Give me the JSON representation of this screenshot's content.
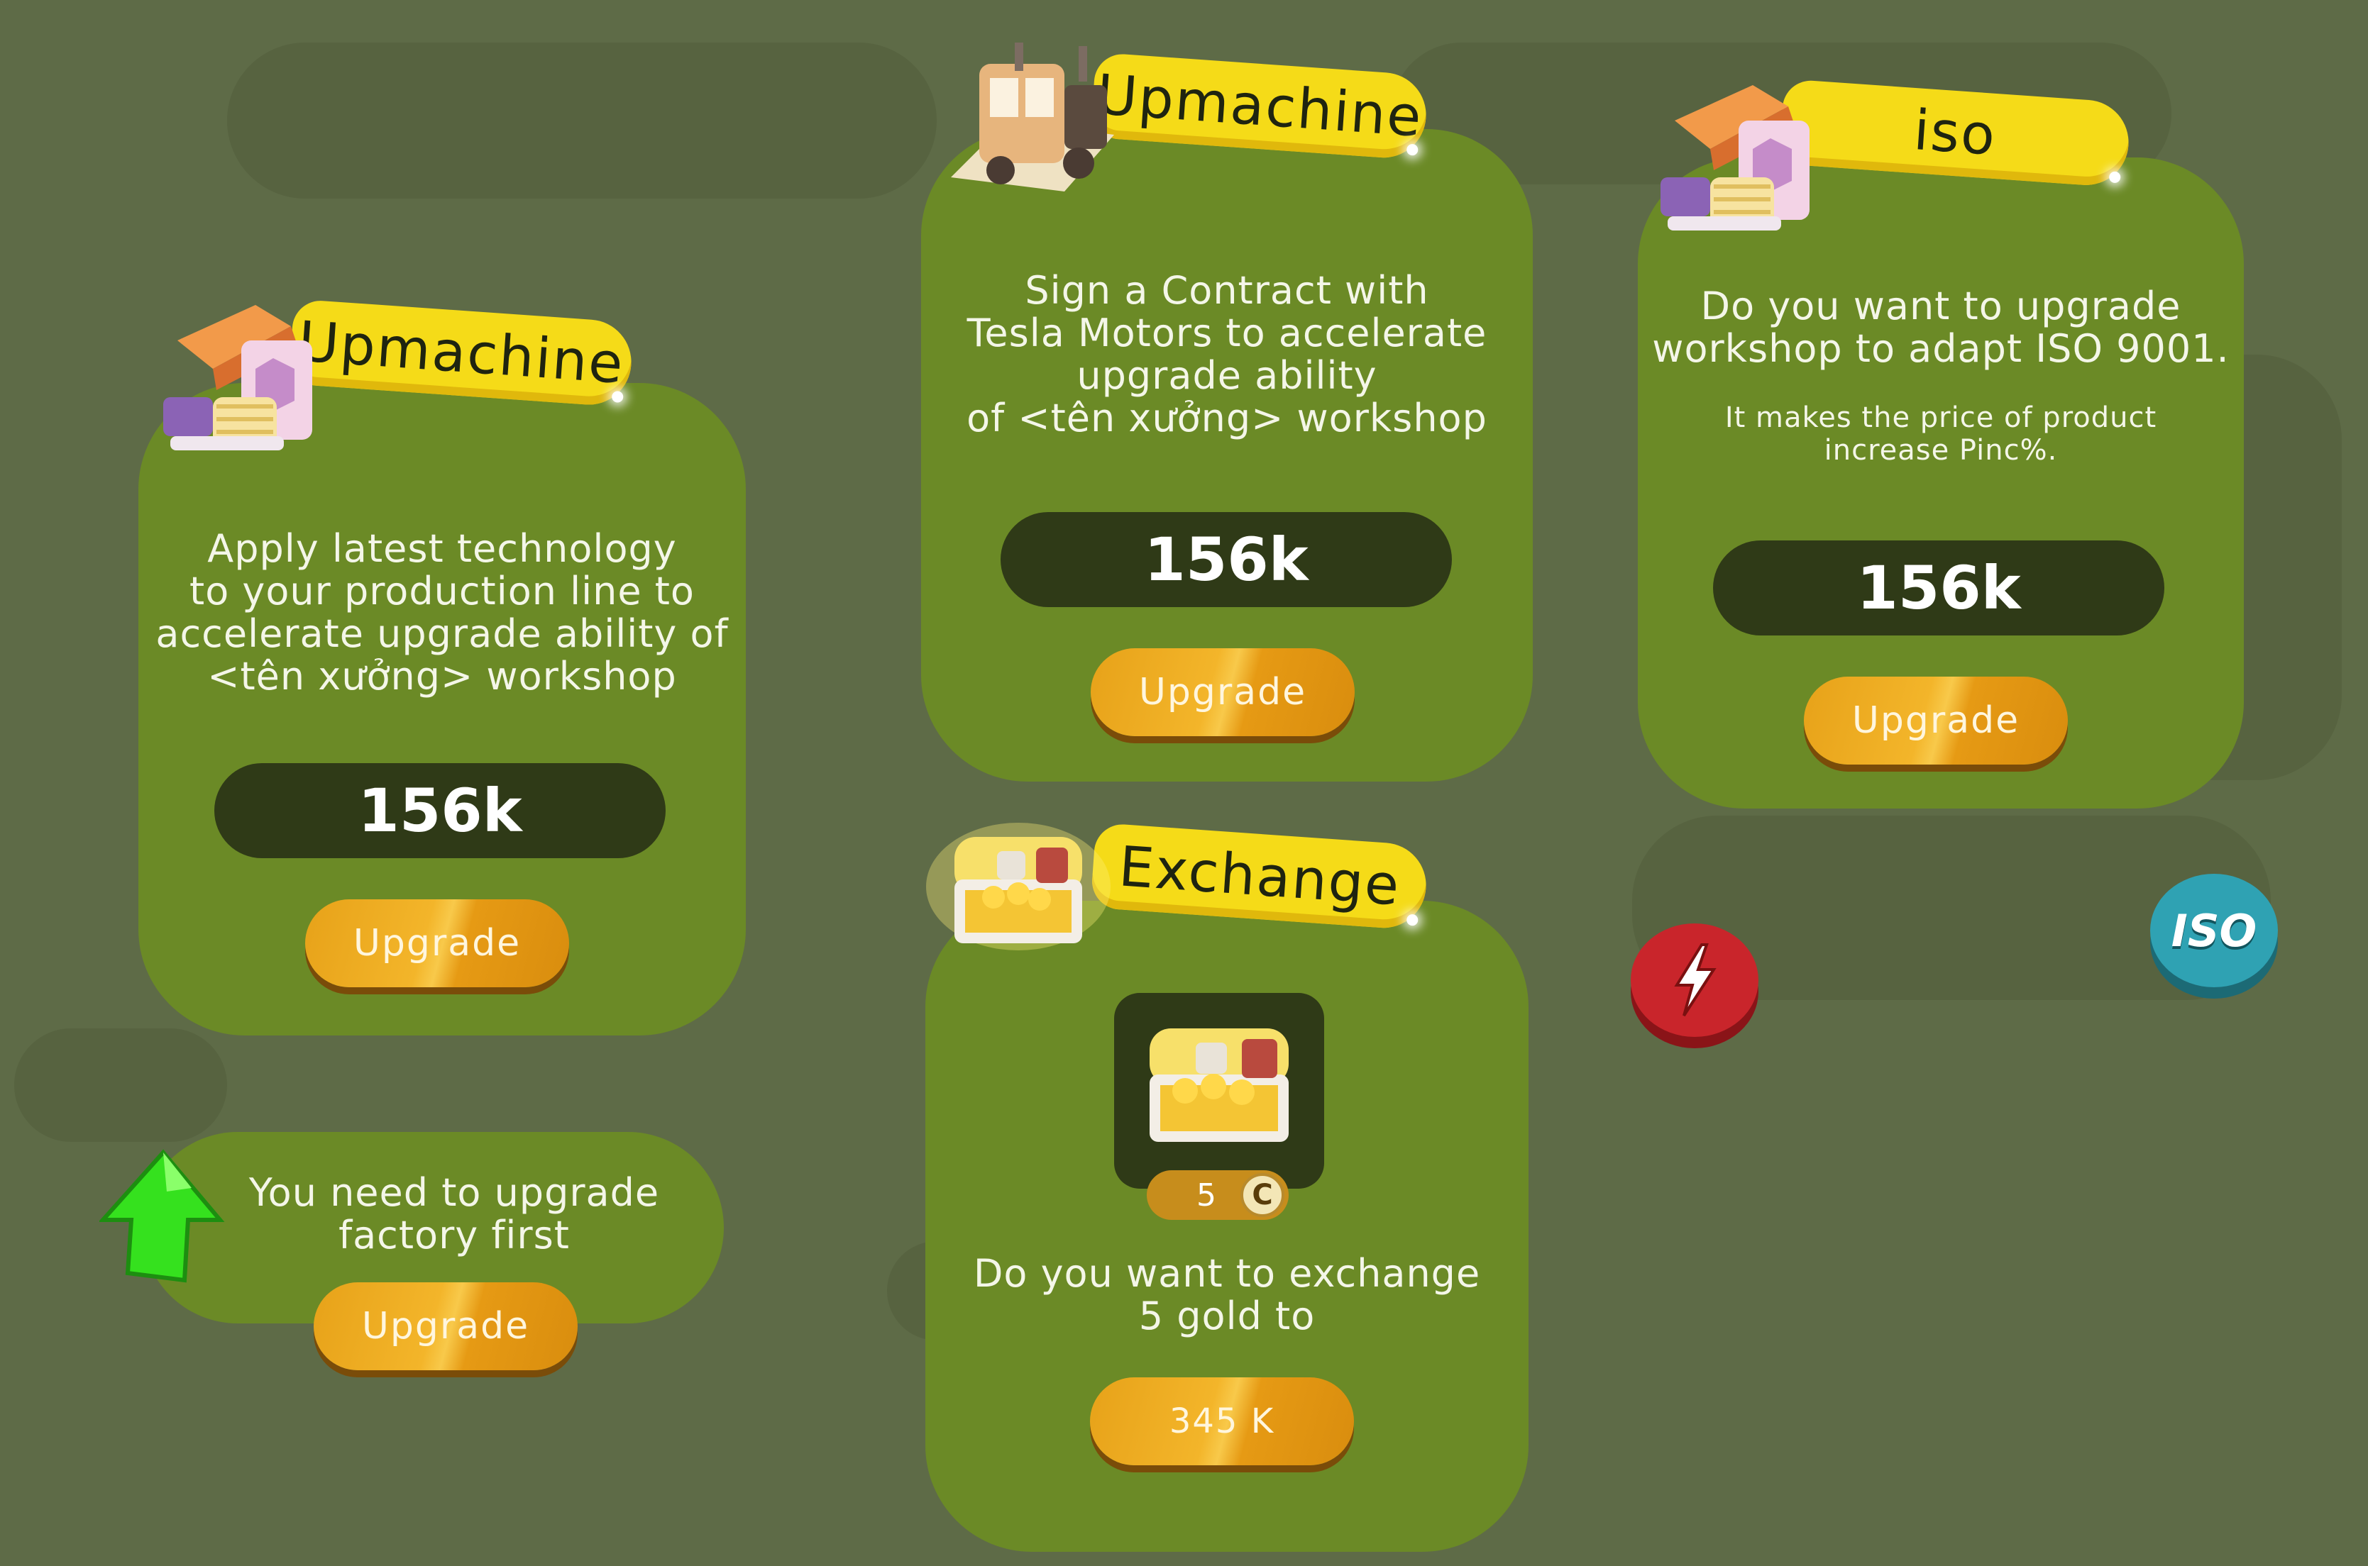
{
  "colors": {
    "background": "#5e6b47",
    "panel": "#6b8a26",
    "ribbon": "#f5db18",
    "price_pill": "#2f3a17",
    "button": "#f0ad22",
    "red_badge": "#c9252b",
    "iso_badge": "#2fa2b3",
    "arrow": "#35e11e"
  },
  "cards": {
    "upmachine_left": {
      "title": "Upmachine",
      "description": [
        "Apply latest technology",
        "to your production line  to",
        "accelerate upgrade ability of",
        "<tên xưởng> workshop"
      ],
      "price": "156k",
      "button_label": "Upgrade",
      "icon": "workshop-icon"
    },
    "upmachine_mid": {
      "title": "Upmachine",
      "description": [
        "Sign a Contract with",
        "Tesla Motors to accelerate",
        "upgrade ability",
        "of <tên xưởng> workshop"
      ],
      "price": "156k",
      "button_label": "Upgrade",
      "icon": "truck-icon"
    },
    "iso": {
      "title": "iso",
      "description": [
        "Do you want to upgrade",
        "workshop to adapt ISO 9001."
      ],
      "note": [
        "It makes the price of product",
        "increase Pinc%."
      ],
      "price": "156k",
      "button_label": "Upgrade",
      "icon": "workshop-icon"
    },
    "exchange": {
      "title": "Exchange",
      "gold_amount": "5",
      "coin_symbol": "C",
      "description": [
        "Do you want to exchange",
        "5 gold to"
      ],
      "button_label": "345 K",
      "icon": "treasure-chest-icon"
    },
    "factory_notice": {
      "message": [
        "You need to upgrade",
        "factory first"
      ],
      "button_label": "Upgrade",
      "icon": "up-arrow-icon"
    }
  },
  "badges": {
    "boost": {
      "icon": "lightning-icon"
    },
    "iso": {
      "label": "ISO"
    }
  }
}
